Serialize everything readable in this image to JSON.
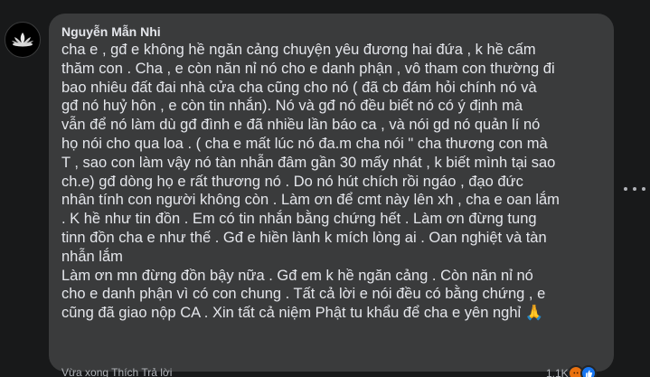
{
  "comment": {
    "author": "Nguyễn Mẫn Nhi",
    "lines": [
      "cha e , gđ e không hề ngăn cảng chuyện yêu đương hai đứa , k hề cấm",
      "thăm con . Cha , e còn năn nỉ nó cho e danh phận , vô tham con thường đi",
      "bao nhiêu đất đai nhà cửa cha cũng cho nó ( đã cb đám hỏi chính nó và",
      "gđ nó huỷ hôn , e còn tin nhắn). Nó và gđ nó đều biết nó có ý định mà",
      "vẫn để nó làm dù gđ đình e đã nhiều lần báo ca , và nói gd nó quản lí nó",
      "họ nói cho qua loa . ( cha e mất lúc nó đa.m cha nói \" cha thương con mà",
      "T , sao con làm vậy nó tàn nhẫn đâm gần 30 mấy nhát , k biết mình tại sao",
      "ch.e) gđ dòng họ e rất thương nó . Do nó hút chích rồi ngáo , đạo đức",
      "nhân tính con người không còn . Làm ơn để cmt này lên xh , cha e oan lắm",
      ". K hề như tin đồn . Em có tin nhắn bằng chứng hết . Làm ơn đừng tung",
      "tinn đồn cha e như thế . Gđ e hiền lành k mích lòng ai . Oan nghiệt và tàn",
      "nhẫn lắm",
      "Làm ơn mn đừng đồn bậy nữa . Gđ em k hề ngăn cảng . Còn năn nỉ nó",
      "cho e danh phận vì có con chung . Tất cả lời e nói đều có bằng chứng , e",
      "cũng đã giao nộp CA . Xin tất cả niệm Phật tu khẩu để cha e yên nghỉ 🙏"
    ]
  },
  "footer": {
    "actions_cut": "Vừa xong   Thích   Trả lời",
    "reaction_count": "1,1K"
  },
  "icons": {
    "avatar": "lotus-avatar-icon",
    "more": "more-horizontal-icon",
    "reactions": [
      "angry-reaction-icon",
      "like-reaction-icon"
    ]
  },
  "colors": {
    "background": "#18191a",
    "bubble": "#3a3b3c",
    "text": "#e4e6eb",
    "secondary_text": "#b0b3b8",
    "like_blue": "#1877f2",
    "angry_orange": "#e9710f"
  }
}
